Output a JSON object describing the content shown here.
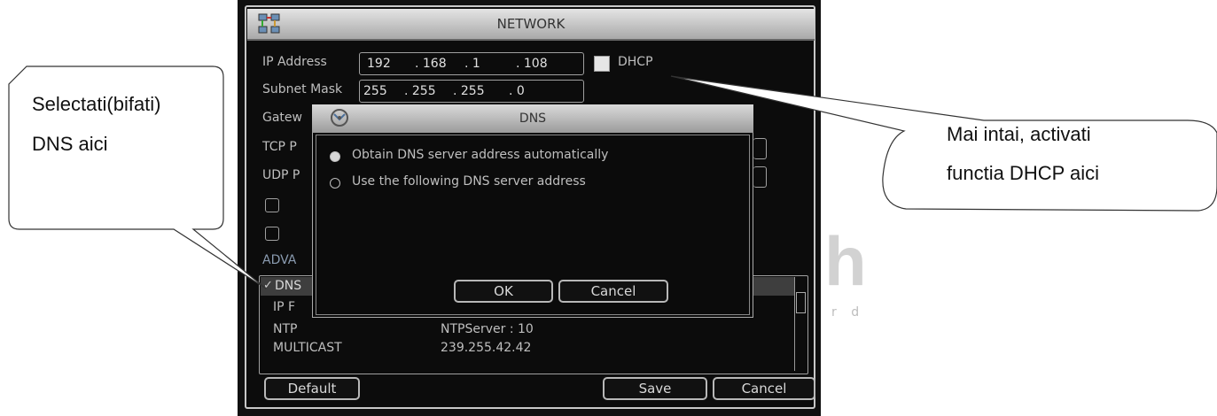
{
  "window": {
    "title": "NETWORK",
    "ip_label": "IP Address",
    "ip": [
      "192",
      ". 168",
      ".  1",
      ". 108"
    ],
    "dhcp_label": "DHCP",
    "mask_label": "Subnet Mask",
    "mask": [
      "255",
      ". 255",
      ". 255",
      ".  0"
    ],
    "gateway_label": "Gatew",
    "tcp_label": "TCP P",
    "udp_label": "UDP P",
    "advanced_label": "ADVA",
    "rows": [
      {
        "name": "DNS",
        "value": ""
      },
      {
        "name": "IP F",
        "value": ""
      },
      {
        "name": "NTP",
        "value": "NTPServer : 10"
      },
      {
        "name": "MULTICAST",
        "value": "239.255.42.42"
      }
    ],
    "default_btn": "Default",
    "save_btn": "Save",
    "cancel_btn": "Cancel"
  },
  "dns_dialog": {
    "title": "DNS",
    "option_auto": "Obtain DNS server address automatically",
    "option_manual": "Use the following DNS server address",
    "ok_btn": "OK",
    "cancel_btn": "Cancel"
  },
  "callouts": {
    "left_line1": "Selectati(bifati)",
    "left_line2": "DNS aici",
    "right_line1": "Mai intai, activati",
    "right_line2": "functia DHCP aici"
  },
  "watermark": {
    "big": "h",
    "small": "r d"
  }
}
